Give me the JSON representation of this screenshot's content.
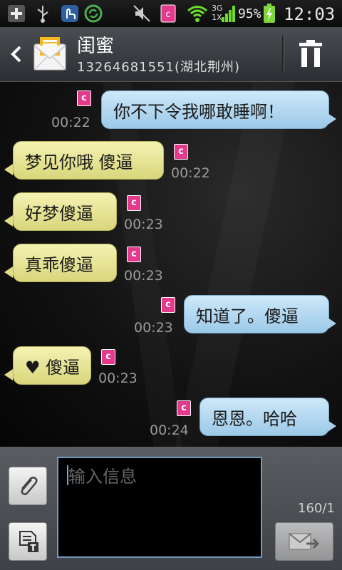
{
  "status_bar": {
    "battery_percent": "95%",
    "time": "12:03",
    "network_3g": "3G",
    "network_1x": "1X",
    "app_badge": "c",
    "colors": {
      "sync": "#4caf50",
      "wifi": "#6ddb2a",
      "battery": "#7fd63a",
      "app_badge": "#e33a8c"
    },
    "icons": [
      "add-icon",
      "usb-icon",
      "touch-icon",
      "sync-icon",
      "mute-icon",
      "app-notification-icon",
      "wifi-icon",
      "signal-icon",
      "battery-icon"
    ]
  },
  "header": {
    "contact_name": "闺蜜",
    "contact_sub": "13264681551(湖北荆州)",
    "icons": [
      "back-icon",
      "envelope-icon",
      "trash-icon"
    ]
  },
  "messages": [
    {
      "direction": "out",
      "text": "你不下令我哪敢睡啊！",
      "time": "00:22",
      "badge": "c"
    },
    {
      "direction": "in",
      "text": "梦见你哦 傻逼",
      "time": "00:22",
      "badge": "c"
    },
    {
      "direction": "in",
      "text": "好梦傻逼",
      "time": "00:23",
      "badge": "c"
    },
    {
      "direction": "in",
      "text": "真乖傻逼",
      "time": "00:23",
      "badge": "c"
    },
    {
      "direction": "out",
      "text": "知道了。傻逼",
      "time": "00:23",
      "badge": "c"
    },
    {
      "direction": "in",
      "text": "♥ 傻逼",
      "time": "00:23",
      "badge": "c"
    },
    {
      "direction": "out",
      "text": "恩恩。哈哈",
      "time": "00:24",
      "badge": "c"
    }
  ],
  "compose": {
    "placeholder": "输入信息",
    "counter": "160/1",
    "icons": [
      "attach-icon",
      "insert-text-icon",
      "send-icon"
    ]
  },
  "colors": {
    "incoming_bubble": "#e8e59a",
    "outgoing_bubble": "#b6d9f1"
  }
}
